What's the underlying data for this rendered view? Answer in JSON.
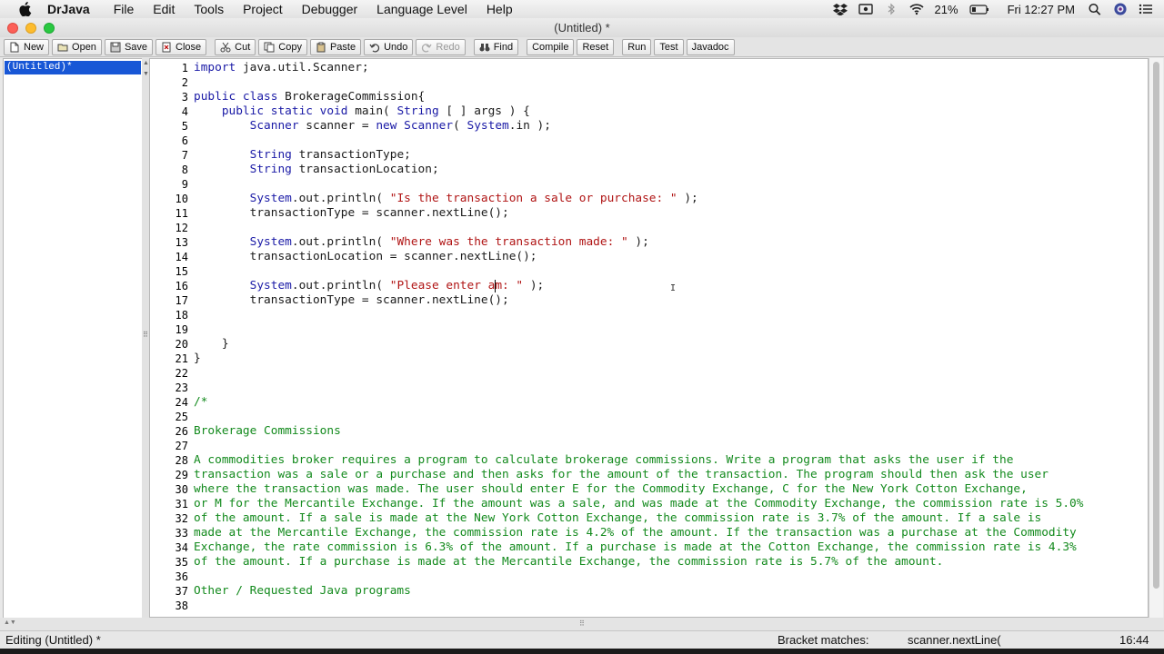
{
  "menubar": {
    "app_name": "DrJava",
    "items": [
      "File",
      "Edit",
      "Tools",
      "Project",
      "Debugger",
      "Language Level",
      "Help"
    ],
    "battery": "21%",
    "clock": "Fri 12:27 PM"
  },
  "window": {
    "title": "(Untitled) *"
  },
  "toolbar": {
    "new": "New",
    "open": "Open",
    "save": "Save",
    "close": "Close",
    "cut": "Cut",
    "copy": "Copy",
    "paste": "Paste",
    "undo": "Undo",
    "redo": "Redo",
    "find": "Find",
    "compile": "Compile",
    "reset": "Reset",
    "run": "Run",
    "test": "Test",
    "javadoc": "Javadoc"
  },
  "documents": [
    "(Untitled)*"
  ],
  "editor": {
    "lines": [
      {
        "n": "1",
        "parts": [
          [
            "kw",
            "import"
          ],
          [
            "pl",
            " java.util.Scanner;"
          ]
        ]
      },
      {
        "n": "2",
        "parts": []
      },
      {
        "n": "3",
        "parts": [
          [
            "kw",
            "public class"
          ],
          [
            "pl",
            " BrokerageCommission{"
          ]
        ]
      },
      {
        "n": "4",
        "parts": [
          [
            "kw",
            "    public static void"
          ],
          [
            "pl",
            " main( "
          ],
          [
            "kw",
            "String"
          ],
          [
            "pl",
            " [ ] args ) {"
          ]
        ]
      },
      {
        "n": "5",
        "parts": [
          [
            "kw",
            "        Scanner"
          ],
          [
            "pl",
            " scanner = "
          ],
          [
            "kw",
            "new Scanner"
          ],
          [
            "pl",
            "( "
          ],
          [
            "kw",
            "System"
          ],
          [
            "pl",
            ".in );"
          ]
        ]
      },
      {
        "n": "6",
        "parts": []
      },
      {
        "n": "7",
        "parts": [
          [
            "kw",
            "        String"
          ],
          [
            "pl",
            " transactionType;"
          ]
        ]
      },
      {
        "n": "8",
        "parts": [
          [
            "kw",
            "        String"
          ],
          [
            "pl",
            " transactionLocation;"
          ]
        ]
      },
      {
        "n": "9",
        "parts": []
      },
      {
        "n": "10",
        "parts": [
          [
            "kw",
            "        System"
          ],
          [
            "pl",
            ".out.println( "
          ],
          [
            "str",
            "\"Is the transaction a sale or purchase: \""
          ],
          [
            "pl",
            " );"
          ]
        ]
      },
      {
        "n": "11",
        "parts": [
          [
            "pl",
            "        transactionType = scanner.nextLine();"
          ]
        ]
      },
      {
        "n": "12",
        "parts": []
      },
      {
        "n": "13",
        "parts": [
          [
            "kw",
            "        System"
          ],
          [
            "pl",
            ".out.println( "
          ],
          [
            "str",
            "\"Where was the transaction made: \""
          ],
          [
            "pl",
            " );"
          ]
        ]
      },
      {
        "n": "14",
        "parts": [
          [
            "pl",
            "        transactionLocation = scanner.nextLine();"
          ]
        ]
      },
      {
        "n": "15",
        "parts": []
      },
      {
        "n": "16",
        "parts": [
          [
            "kw",
            "        System"
          ],
          [
            "pl",
            ".out.println( "
          ],
          [
            "str",
            "\"Please enter am: \""
          ],
          [
            "pl",
            " );"
          ]
        ]
      },
      {
        "n": "17",
        "parts": [
          [
            "pl",
            "        transactionType = scanner.nextLine();"
          ]
        ]
      },
      {
        "n": "18",
        "parts": []
      },
      {
        "n": "19",
        "parts": []
      },
      {
        "n": "20",
        "parts": [
          [
            "pl",
            "    }"
          ]
        ]
      },
      {
        "n": "21",
        "parts": [
          [
            "pl",
            "}"
          ]
        ]
      },
      {
        "n": "22",
        "parts": []
      },
      {
        "n": "23",
        "parts": []
      },
      {
        "n": "24",
        "parts": [
          [
            "cm",
            "/*"
          ]
        ]
      },
      {
        "n": "25",
        "parts": []
      },
      {
        "n": "26",
        "parts": [
          [
            "cm",
            "Brokerage Commissions"
          ]
        ]
      },
      {
        "n": "27",
        "parts": []
      },
      {
        "n": "28",
        "parts": [
          [
            "cm",
            "A commodities broker requires a program to calculate brokerage commissions. Write a program that asks the user if the"
          ]
        ]
      },
      {
        "n": "29",
        "parts": [
          [
            "cm",
            "transaction was a sale or a purchase and then asks for the amount of the transaction. The program should then ask the user"
          ]
        ]
      },
      {
        "n": "30",
        "parts": [
          [
            "cm",
            "where the transaction was made. The user should enter E for the Commodity Exchange, C for the New York Cotton Exchange,"
          ]
        ]
      },
      {
        "n": "31",
        "parts": [
          [
            "cm",
            "or M for the Mercantile Exchange. If the amount was a sale, and was made at the Commodity Exchange, the commission rate is 5.0%"
          ]
        ]
      },
      {
        "n": "32",
        "parts": [
          [
            "cm",
            "of the amount. If a sale is made at the New York Cotton Exchange, the commission rate is 3.7% of the amount. If a sale is"
          ]
        ]
      },
      {
        "n": "33",
        "parts": [
          [
            "cm",
            "made at the Mercantile Exchange, the commission rate is 4.2% of the amount. If the transaction was a purchase at the Commodity"
          ]
        ]
      },
      {
        "n": "34",
        "parts": [
          [
            "cm",
            "Exchange, the rate commission is 6.3% of the amount. If a purchase is made at the Cotton Exchange, the commission rate is 4.3%"
          ]
        ]
      },
      {
        "n": "35",
        "parts": [
          [
            "cm",
            "of the amount. If a purchase is made at the Mercantile Exchange, the commission rate is 5.7% of the amount."
          ]
        ]
      },
      {
        "n": "36",
        "parts": []
      },
      {
        "n": "37",
        "parts": [
          [
            "cm",
            "Other / Requested Java programs"
          ]
        ]
      },
      {
        "n": "38",
        "parts": []
      }
    ],
    "caret": {
      "line": 16,
      "column": 43
    }
  },
  "status": {
    "editing": "Editing (Untitled) *",
    "bracket_label": "Bracket matches:",
    "bracket_value": "scanner.nextLine(",
    "position": "16:44"
  },
  "colors": {
    "keyword": "#1a1aa6",
    "string": "#b01414",
    "comment": "#138a1d",
    "selection": "#1857d6"
  }
}
